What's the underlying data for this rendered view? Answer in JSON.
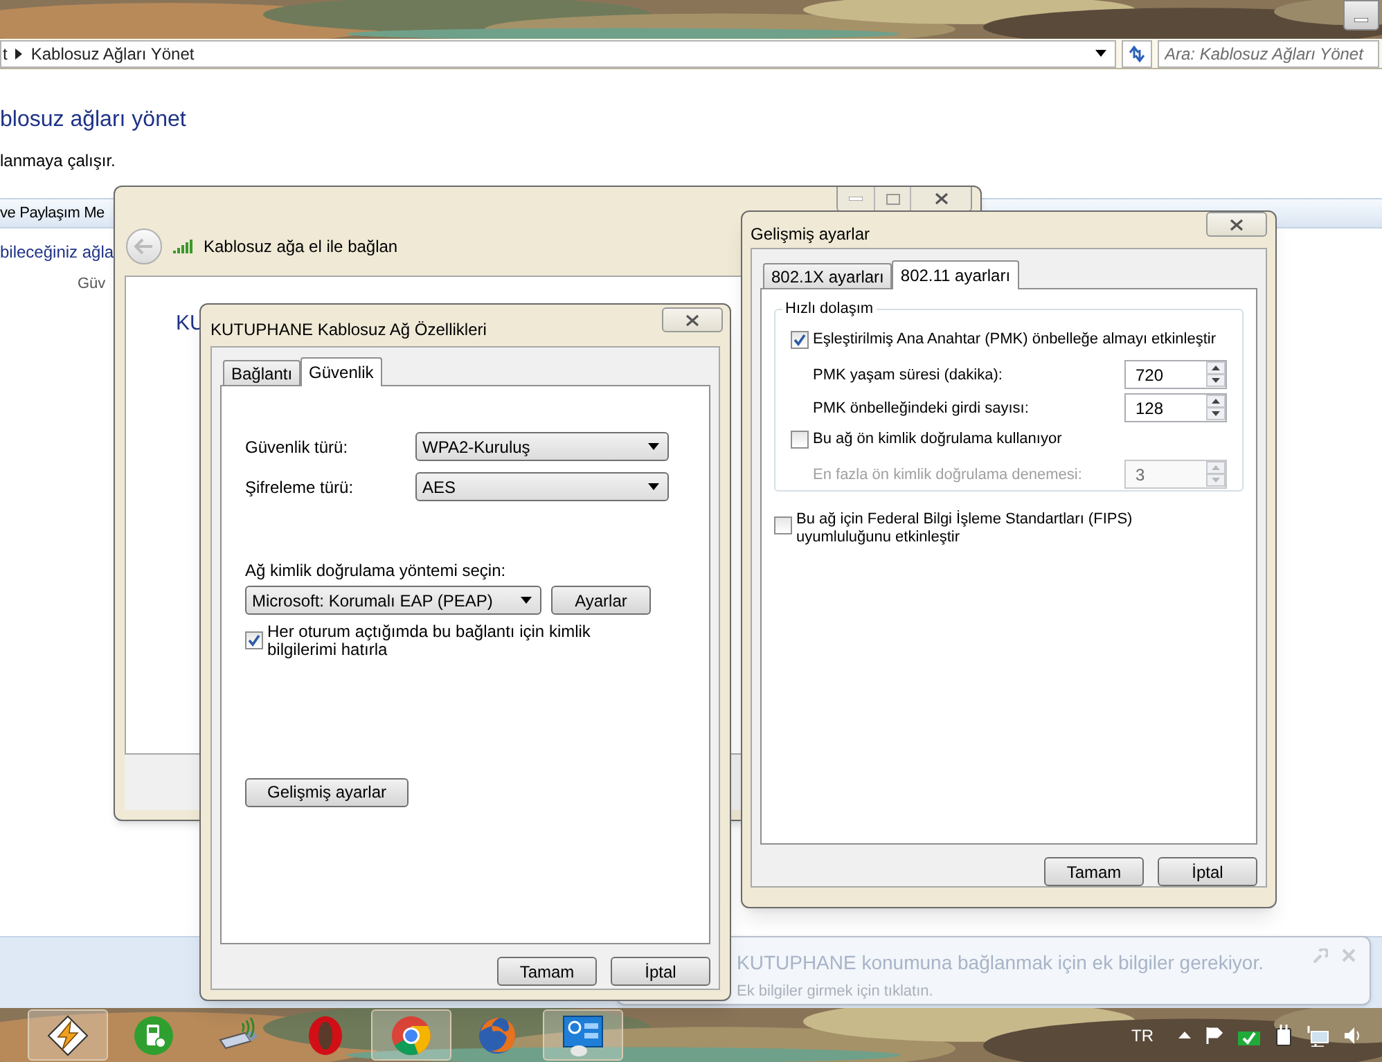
{
  "address_bar": {
    "breadcrumb": [
      {
        "label": "t"
      },
      {
        "label": "Kablosuz Ağları Yönet"
      }
    ],
    "search": {
      "placeholder": "Ara: Kablosuz Ağları Yönet"
    }
  },
  "explorer": {
    "heading": "blosuz ağları yönet",
    "description": "lanmaya çalışır.",
    "toolbar_label": "ve Paylaşım Me",
    "list_title": "bileceğiniz ağla",
    "list_subtitle": "Güv"
  },
  "connect_window": {
    "title": "Kablosuz ağa el ile bağlan",
    "network_name": "KU"
  },
  "properties_dialog": {
    "title": "KUTUPHANE Kablosuz Ağ Özellikleri",
    "tabs": [
      {
        "label": "Bağlantı",
        "selected": false
      },
      {
        "label": "Güvenlik",
        "selected": true
      }
    ],
    "fields": [
      {
        "label": "Güvenlik türü:",
        "value": "WPA2-Kuruluş"
      },
      {
        "label": "Şifreleme türü:",
        "value": "AES"
      }
    ],
    "auth_label": "Ağ kimlik doğrulama yöntemi seçin:",
    "auth_method": "Microsoft: Korumalı EAP (PEAP)",
    "auth_settings_button": "Ayarlar",
    "remember": {
      "label": "Her oturum açtığımda bu bağlantı için kimlik bilgilerimi hatırla",
      "checked": true
    },
    "advanced_button": "Gelişmiş ayarlar",
    "buttons": [
      "Tamam",
      "İptal"
    ]
  },
  "advanced_dialog": {
    "title": "Gelişmiş ayarlar",
    "tabs": [
      {
        "label": "802.1X ayarları",
        "selected": false
      },
      {
        "label": "802.11 ayarları",
        "selected": true
      }
    ],
    "group_title": "Hızlı dolaşım",
    "items": [
      {
        "kind": "checkbox",
        "label": "Eşleştirilmiş Ana Anahtar (PMK) önbelleğe almayı etkinleştir",
        "checked": true,
        "disabled": false
      },
      {
        "kind": "spinner",
        "label": "PMK yaşam süresi (dakika):",
        "value": "720",
        "disabled": false
      },
      {
        "kind": "spinner",
        "label": "PMK önbelleğindeki girdi sayısı:",
        "value": "128",
        "disabled": false
      },
      {
        "kind": "checkbox",
        "label": "Bu ağ ön kimlik doğrulama kullanıyor",
        "checked": false,
        "disabled": false
      },
      {
        "kind": "spinner",
        "label": "En fazla ön kimlik doğrulama denemesi:",
        "value": "3",
        "disabled": true
      }
    ],
    "fips": {
      "label": "Bu ağ için Federal Bilgi İşleme Standartları (FIPS) uyumluluğunu etkinleştir",
      "checked": false
    },
    "buttons": [
      "Tamam",
      "İptal"
    ]
  },
  "notification": {
    "title": "KUTUPHANE konumuna bağlanmak için ek bilgiler gerekiyor.",
    "message": "Ek bilgiler girmek için tıklatın."
  },
  "taskbar": {
    "apps": [
      {
        "kind": "lightning",
        "open": true
      },
      {
        "kind": "phone",
        "open": false
      },
      {
        "kind": "usb",
        "open": false
      },
      {
        "kind": "ring",
        "open": false
      },
      {
        "kind": "chrome",
        "open": true
      },
      {
        "kind": "fox",
        "open": false
      },
      {
        "kind": "panel",
        "open": true
      }
    ],
    "language": "TR"
  }
}
